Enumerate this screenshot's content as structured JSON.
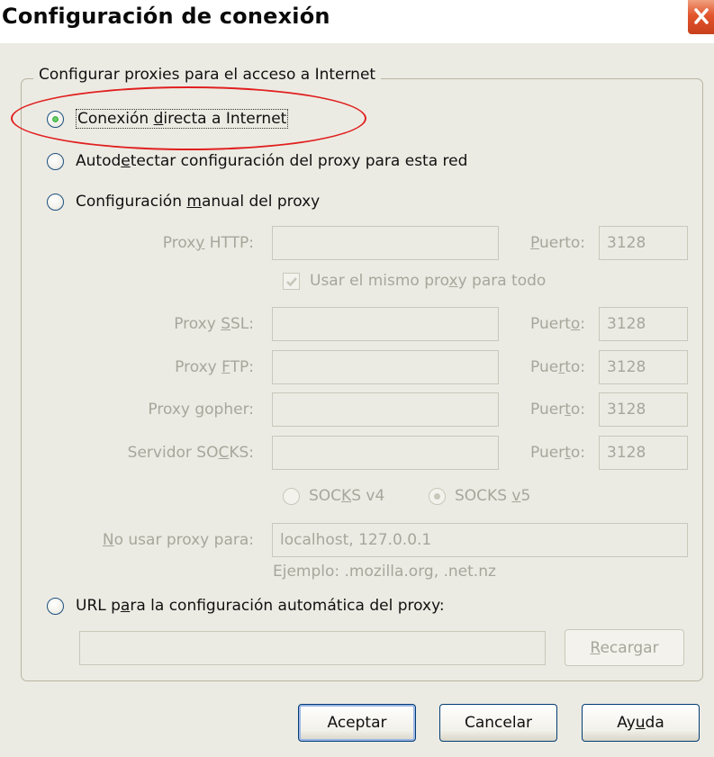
{
  "window": {
    "title": "Configuración de conexión",
    "close_icon": "close-icon"
  },
  "group": {
    "legend": "Configurar proxies para el acceso a Internet"
  },
  "options": {
    "direct": {
      "pre": "Conexión ",
      "key": "d",
      "post": "irecta a Internet",
      "checked": true
    },
    "autodetect": {
      "pre": "Autod",
      "key": "e",
      "post": "tectar configuración del proxy para esta red",
      "checked": false
    },
    "manual": {
      "pre": "Configuración ",
      "key": "m",
      "post": "anual del proxy",
      "checked": false
    },
    "autourl": {
      "pre": "URL p",
      "key": "a",
      "post": "ra la configuración automática del proxy:",
      "checked": false
    }
  },
  "proxies": {
    "http": {
      "label_pre": "Prox",
      "label_key": "y",
      "label_post": " HTTP:",
      "host": "",
      "port_label_pre": "",
      "port_label_key": "P",
      "port_label_post": "uerto:",
      "port": "3128"
    },
    "ssl": {
      "label_pre": "Proxy ",
      "label_key": "S",
      "label_post": "SL:",
      "host": "",
      "port_label_pre": "Puert",
      "port_label_key": "o",
      "port_label_post": ":",
      "port": "3128"
    },
    "ftp": {
      "label_pre": "Proxy ",
      "label_key": "F",
      "label_post": "TP:",
      "host": "",
      "port_label_pre": "Pue",
      "port_label_key": "r",
      "port_label_post": "to:",
      "port": "3128"
    },
    "gopher": {
      "label_pre": "Proxy ",
      "label_key": "g",
      "label_post": "opher:",
      "host": "",
      "port_label_pre": "Puer",
      "port_label_key": "t",
      "port_label_post": "o:",
      "port": "3128"
    },
    "socks": {
      "label_pre": "Servidor SO",
      "label_key": "C",
      "label_post": "KS:",
      "host": "",
      "port_label_pre": "Puer",
      "port_label_key": "t",
      "port_label_post": "o:",
      "port": "3128"
    }
  },
  "same_proxy": {
    "pre": "Usar el mismo pro",
    "key": "x",
    "post": "y para todo",
    "checked": true
  },
  "socks_version": {
    "v4": {
      "pre": "SOC",
      "key": "K",
      "post": "S v4",
      "checked": false
    },
    "v5": {
      "pre": "SOCKS ",
      "key": "v",
      "post": "5",
      "checked": true
    }
  },
  "no_proxy": {
    "label_key": "N",
    "label_post": "o usar proxy para:",
    "value": "localhost, 127.0.0.1",
    "example": "Ejemplo: .mozilla.org, .net.nz"
  },
  "autoconfig": {
    "url": "",
    "reload_key": "R",
    "reload_post": "ecargar"
  },
  "buttons": {
    "ok": "Aceptar",
    "cancel": "Cancelar",
    "help_pre": "Ay",
    "help_key": "u",
    "help_post": "da"
  },
  "colors": {
    "highlight": "#e02020",
    "disabled_text": "#a7a69b",
    "dialog_bg": "#ecebe3"
  }
}
